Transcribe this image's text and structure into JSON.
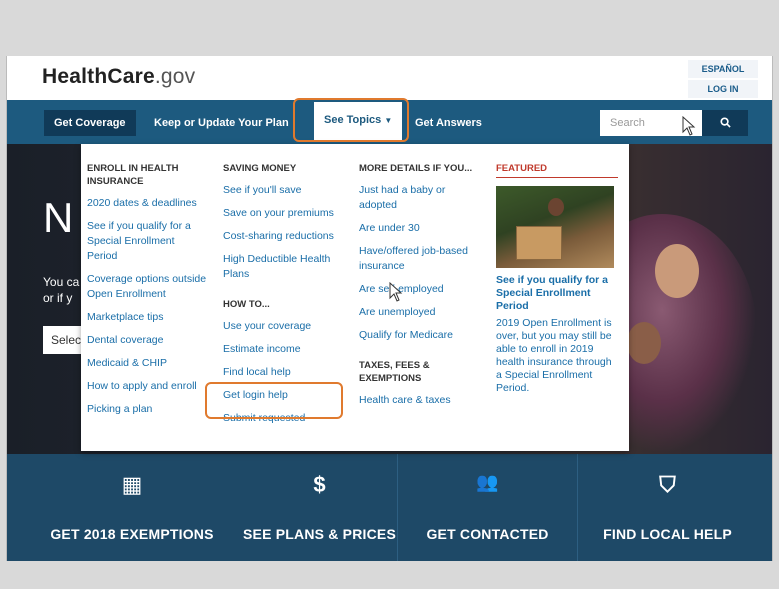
{
  "header": {
    "logo_main": "HealthCare",
    "logo_tld": ".gov",
    "espanol": "ESPAÑOL",
    "login": "LOG IN"
  },
  "nav": {
    "get_coverage": "Get Coverage",
    "keep_update": "Keep or Update Your Plan",
    "see_topics": "See Topics",
    "get_answers": "Get Answers",
    "search_placeholder": "Search"
  },
  "hero": {
    "title_partial": "N",
    "line1": "You ca",
    "line2": "or if y",
    "select_partial": "Selec"
  },
  "menu": {
    "col1": {
      "heading": "ENROLL IN HEALTH INSURANCE",
      "links": [
        "2020 dates & deadlines",
        "See if you qualify for a Special Enrollment Period",
        "Coverage options outside Open Enrollment",
        "Marketplace tips",
        "Dental coverage",
        "Medicaid & CHIP",
        "How to apply and enroll",
        "Picking a plan"
      ]
    },
    "col2": {
      "heading": "SAVING MONEY",
      "links": [
        "See if you'll save",
        "Save on your premiums",
        "Cost-sharing reductions",
        "High Deductible Health Plans"
      ],
      "heading2": "HOW TO...",
      "links2": [
        "Use your coverage",
        "Estimate income",
        "Find local help",
        "Get login help",
        "Submit requested"
      ]
    },
    "col3": {
      "heading": "MORE DETAILS IF YOU...",
      "links": [
        "Just had a baby or adopted",
        "Are under 30",
        "Have/offered job-based insurance",
        "Are self-employed",
        "Are unemployed",
        "Qualify for Medicare"
      ],
      "heading2": "TAXES, FEES & EXEMPTIONS",
      "links2": [
        "Health care & taxes"
      ]
    },
    "featured": {
      "heading": "FEATURED",
      "title": "See if you qualify for a Special Enrollment Period",
      "body": "2019 Open Enrollment is over, but you may still be able to enroll in 2019 health insurance through a Special Enrollment Period."
    }
  },
  "tiles": [
    {
      "icon": "calculator-icon",
      "glyph": "▦",
      "label": "GET 2018 EXEMPTIONS"
    },
    {
      "icon": "dollar-icon",
      "glyph": "$",
      "label": "SEE PLANS & PRICES"
    },
    {
      "icon": "people-icon",
      "glyph": "👥",
      "label": "GET CONTACTED"
    },
    {
      "icon": "road-icon",
      "glyph": "⛉",
      "label": "FIND LOCAL HELP"
    }
  ],
  "colors": {
    "nav_bg": "#1d5a7f",
    "highlight": "#e07a2e",
    "link": "#1a6ea8",
    "featured": "#c0392b"
  }
}
